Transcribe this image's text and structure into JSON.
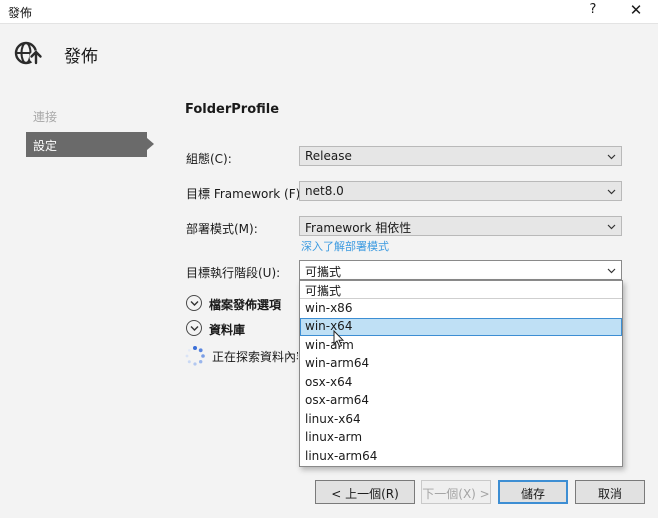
{
  "window": {
    "title": "發佈",
    "help": "?",
    "close": "✕"
  },
  "header": {
    "title": "發佈"
  },
  "nav": {
    "items": [
      {
        "label": "連接"
      },
      {
        "label": "設定"
      }
    ]
  },
  "profile": {
    "name": "FolderProfile"
  },
  "settings": {
    "configuration": {
      "label": "組態(C):",
      "value": "Release"
    },
    "framework": {
      "label": "目標 Framework (F):",
      "value": "net8.0"
    },
    "deployment": {
      "label": "部署模式(M):",
      "value": "Framework 相依性",
      "link": "深入了解部署模式"
    },
    "runtime": {
      "label": "目標執行階段(U):",
      "value": "可攜式"
    }
  },
  "dropdown": {
    "options": [
      "可攜式",
      "win-x86",
      "win-x64",
      "win-arm",
      "win-arm64",
      "osx-x64",
      "osx-arm64",
      "linux-x64",
      "linux-arm",
      "linux-arm64"
    ],
    "highlighted": "win-x64"
  },
  "sections": {
    "file_publish": "檔案發佈選項",
    "database": "資料庫"
  },
  "status": {
    "loading": "正在探索資料內容"
  },
  "buttons": {
    "prev": "< 上一個(R)",
    "next": "下一個(X) >",
    "save": "儲存",
    "cancel": "取消"
  },
  "colors": {
    "nav_selected": "#6a6a6a",
    "link": "#3b9ae0",
    "highlight": "#bfe0f5",
    "accent_border": "#3d8ed3"
  }
}
